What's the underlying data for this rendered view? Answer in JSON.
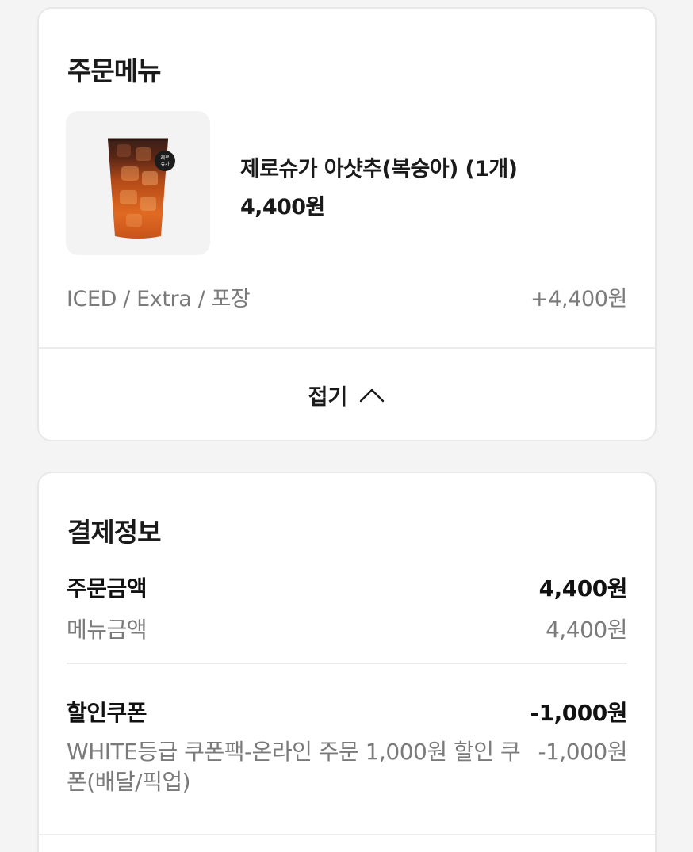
{
  "order_menu": {
    "title": "주문메뉴",
    "item": {
      "name": "제로슈가 아샷추(복숭아) (1개)",
      "price": "4,400원",
      "badge_text": "제로 슈가",
      "options": "ICED / Extra / 포장",
      "options_price": "+4,400원"
    },
    "collapse_label": "접기"
  },
  "payment_info": {
    "title": "결제정보",
    "order_amount_label": "주문금액",
    "order_amount_value": "4,400원",
    "menu_amount_label": "메뉴금액",
    "menu_amount_value": "4,400원",
    "coupon_label": "할인쿠폰",
    "coupon_value": "-1,000원",
    "coupon_detail_label": "WHITE등급 쿠폰팩-온라인 주문 1,000원 할인 쿠폰(배달/픽업)",
    "coupon_detail_value": "-1,000원"
  },
  "colors": {
    "text_primary": "#1a1a1a",
    "text_secondary": "#7a7a7a",
    "divider": "#ececee",
    "drink": "#d9621c"
  },
  "icons": {
    "collapse": "chevron-up-icon"
  }
}
